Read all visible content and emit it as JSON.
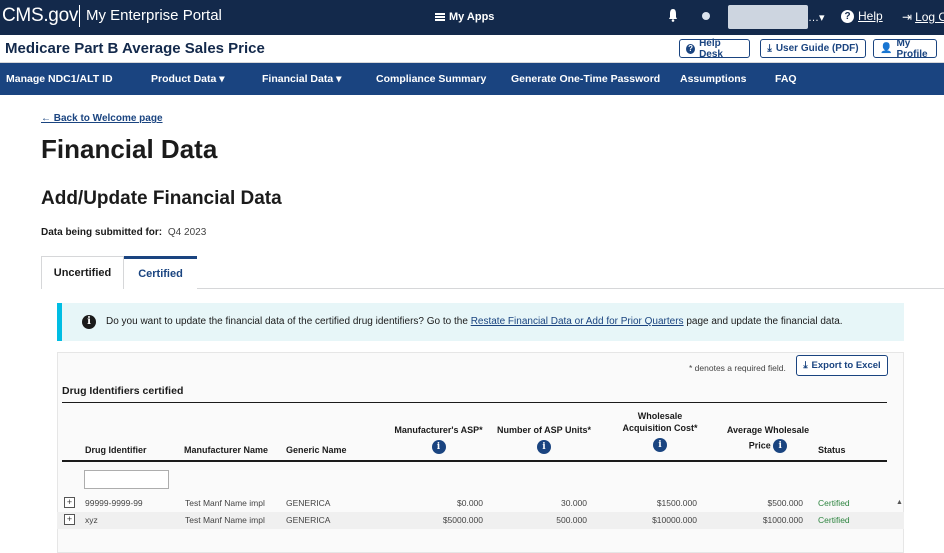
{
  "topbar": {
    "brand": "CMS.gov",
    "portal": "My Enterprise Portal",
    "my_apps": "My Apps",
    "help": "Help",
    "logout": "Log Out"
  },
  "titlebar": {
    "title": "Medicare Part B Average Sales Price",
    "help_desk": "Help Desk",
    "user_guide": "User Guide (PDF)",
    "my_profile": "My Profile"
  },
  "nav": {
    "items": [
      {
        "label": "Manage NDC1/ALT ID"
      },
      {
        "label": "Product Data ▾"
      },
      {
        "label": "Financial Data ▾"
      },
      {
        "label": "Compliance Summary"
      },
      {
        "label": "Generate One-Time Password"
      },
      {
        "label": "Assumptions"
      },
      {
        "label": "FAQ"
      }
    ]
  },
  "page": {
    "back_link": "← Back to Welcome page",
    "title": "Financial Data",
    "subtitle": "Add/Update Financial Data",
    "submitted_label": "Data being submitted for:",
    "submitted_value": "Q4 2023"
  },
  "tabs": [
    {
      "label": "Uncertified",
      "active": false
    },
    {
      "label": "Certified",
      "active": true
    }
  ],
  "alert": {
    "text_before": "Do you want to update the financial data of the certified drug identifiers? Go to the ",
    "link": "Restate Financial Data or Add for Prior Quarters",
    "text_after": " page and update the financial data."
  },
  "table": {
    "required_note": "* denotes a required field.",
    "export_label": "Export to Excel",
    "section_label": "Drug Identifiers certified",
    "headers": {
      "drug_identifier": "Drug Identifier",
      "manufacturer_name": "Manufacturer Name",
      "generic_name": "Generic Name",
      "asp": "Manufacturer's ASP*",
      "units": "Number of ASP Units*",
      "wac_line1": "Wholesale",
      "wac_line2": "Acquisition Cost*",
      "awp_line1": "Average Wholesale",
      "awp_line2": "Price",
      "status": "Status"
    },
    "rows": [
      {
        "drug_identifier": "99999-9999-99",
        "manufacturer": "Test Manf Name impl",
        "generic": "GENERICA",
        "asp": "$0.000",
        "units": "30.000",
        "wac": "$1500.000",
        "awp": "$500.000",
        "status": "Certified"
      },
      {
        "drug_identifier": "xyz",
        "manufacturer": "Test Manf Name impl",
        "generic": "GENERICA",
        "asp": "$5000.000",
        "units": "500.000",
        "wac": "$10000.000",
        "awp": "$1000.000",
        "status": "Certified"
      }
    ]
  },
  "colors": {
    "topbar": "#13294b",
    "nav": "#1a4480",
    "alert_border": "#00bde3",
    "status_certified": "#2e8540"
  }
}
